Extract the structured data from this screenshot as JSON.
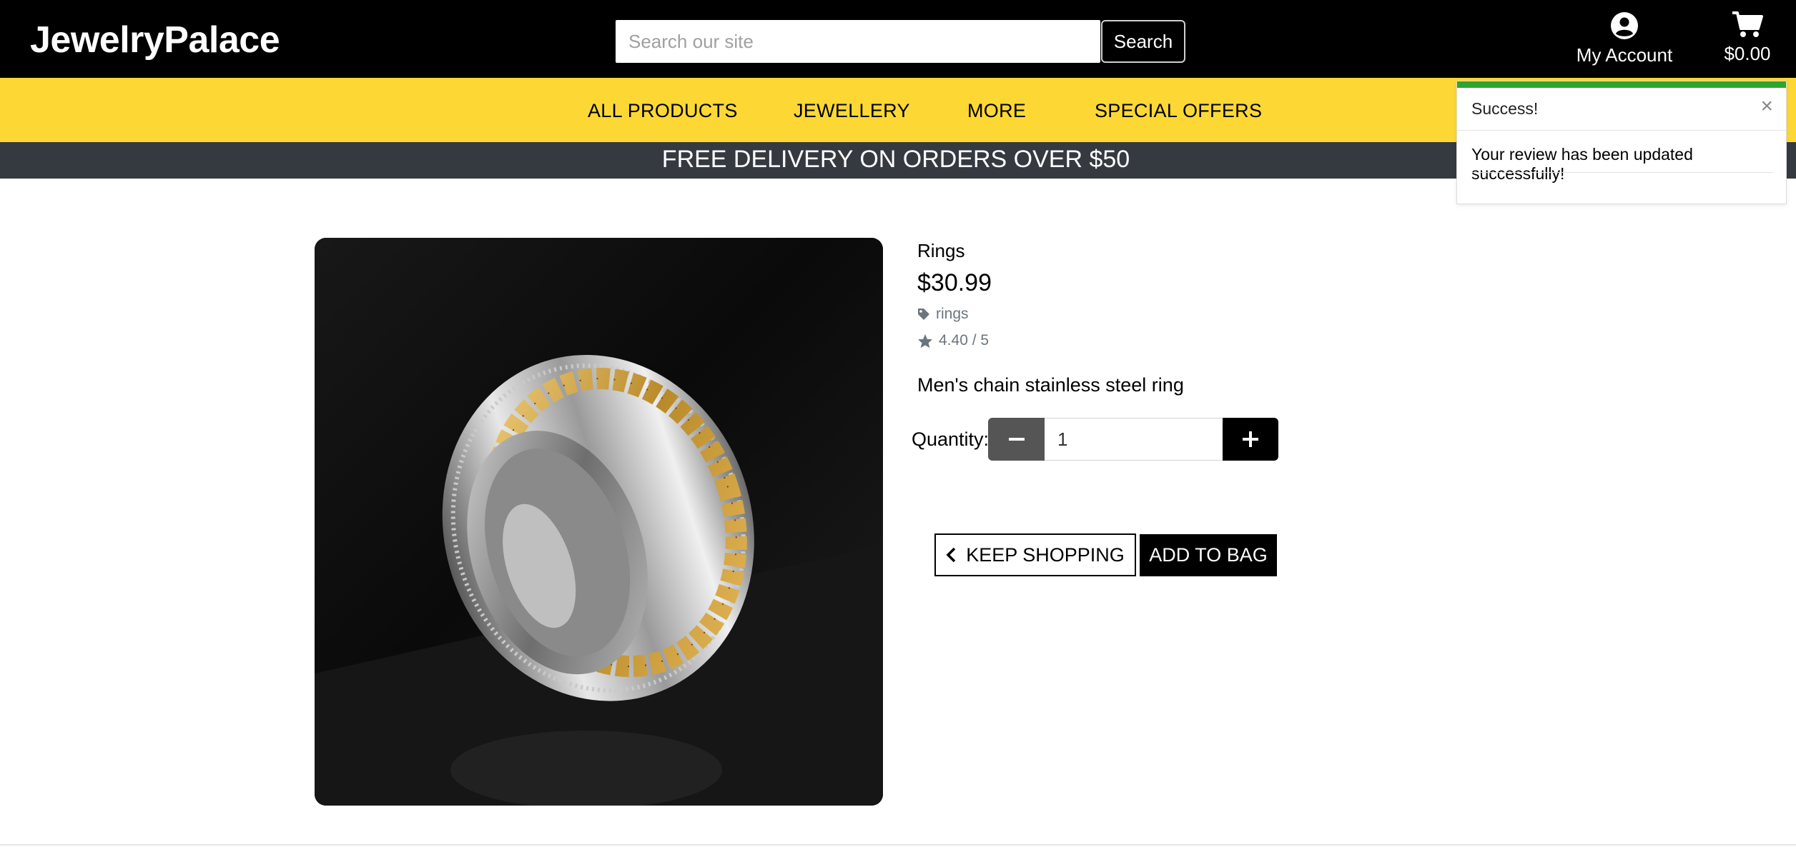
{
  "header": {
    "logo": "JewelryPalace",
    "search_placeholder": "Search our site",
    "search_button": "Search",
    "account_label": "My Account",
    "cart_total": "$0.00"
  },
  "nav": {
    "items": [
      "ALL PRODUCTS",
      "JEWELLERY",
      "MORE",
      "SPECIAL OFFERS"
    ]
  },
  "banner": {
    "text": "FREE DELIVERY ON ORDERS OVER $50"
  },
  "product": {
    "category": "Rings",
    "price": "$30.99",
    "tag": "rings",
    "rating": "4.40 / 5",
    "description": "Men's chain stainless steel ring",
    "quantity_label": "Quantity:",
    "quantity_value": "1",
    "keep_shopping": "KEEP SHOPPING",
    "add_to_bag": "ADD TO BAG"
  },
  "toast": {
    "title": "Success!",
    "message": "Your review has been updated successfully!",
    "accent_color": "#2ea52e"
  },
  "colors": {
    "header_bg": "#000000",
    "nav_bg": "#fdd835",
    "banner_bg": "#343a40"
  },
  "icons": {
    "account": "user-circle-icon",
    "cart": "shopping-cart-icon",
    "tag": "tag-icon",
    "rating": "star-icon",
    "minus": "minus-icon",
    "plus": "plus-icon",
    "back": "chevron-left-icon",
    "close": "close-icon"
  }
}
